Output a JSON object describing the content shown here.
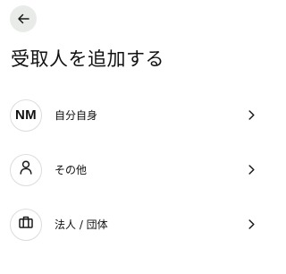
{
  "header": {
    "back_icon": "arrow-left-icon",
    "title": "受取人を追加する"
  },
  "options": [
    {
      "avatar_type": "initials",
      "initials": "NM",
      "label": "自分自身",
      "chevron_icon": "chevron-right-icon"
    },
    {
      "avatar_type": "icon",
      "icon": "person-icon",
      "label": "その他",
      "chevron_icon": "chevron-right-icon"
    },
    {
      "avatar_type": "icon",
      "icon": "briefcase-icon",
      "label": "法人 / 団体",
      "chevron_icon": "chevron-right-icon"
    }
  ],
  "colors": {
    "back_button_bg": "#e8ebe8",
    "text": "#111111",
    "avatar_border": "#dcdcdc"
  }
}
